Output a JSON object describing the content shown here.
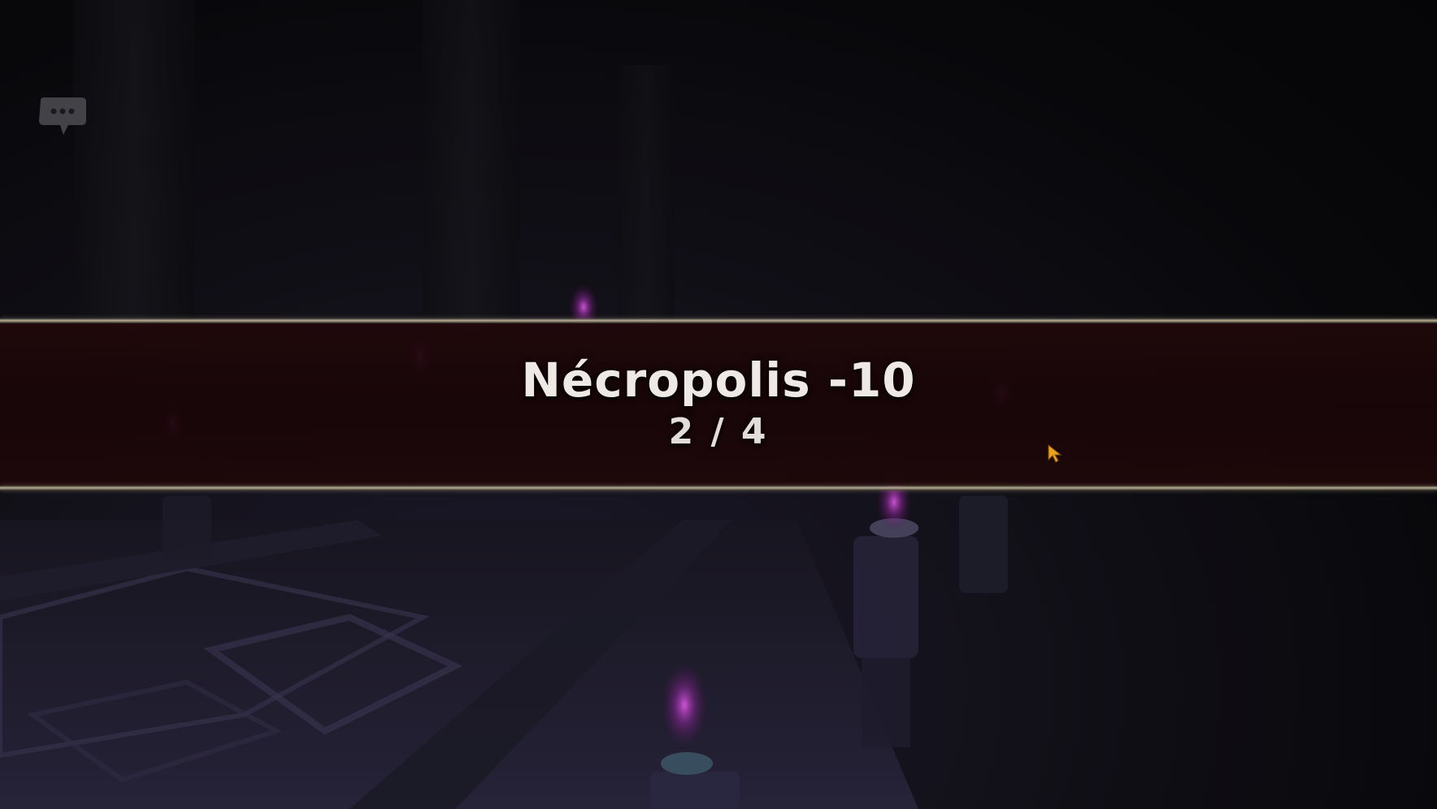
{
  "hud": {
    "chat_icon": "chat-bubble-icon"
  },
  "zone_banner": {
    "title": "Nécropolis -10",
    "progress_text": "2 / 4",
    "progress": {
      "current": 2,
      "total": 4
    }
  },
  "colors": {
    "banner_band": "#1e0608",
    "banner_rule": "#b7ae94",
    "title_text": "#efe9e6",
    "torch_flame": "#c23fd0",
    "cursor": "#e8a21a"
  }
}
